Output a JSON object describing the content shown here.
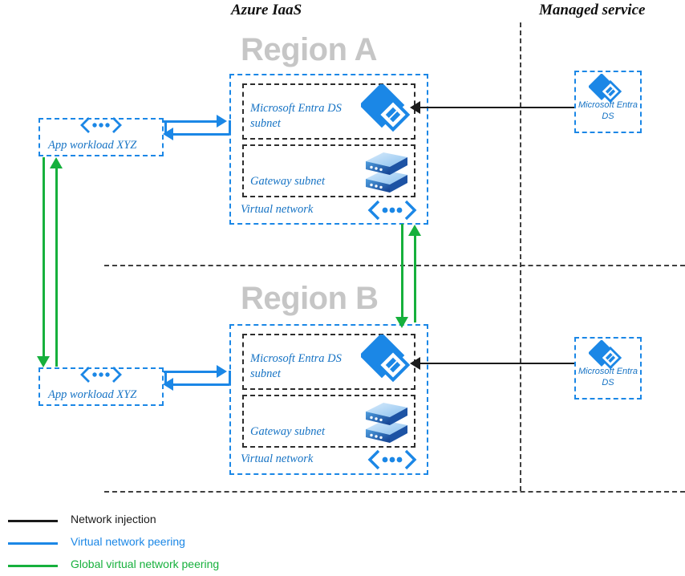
{
  "headers": {
    "azure_iaas": "Azure IaaS",
    "managed_service": "Managed service"
  },
  "regions": [
    {
      "title": "Region A",
      "vnet_label": "Virtual network",
      "vnet_icon": "virtual-network-icon",
      "subnets": [
        {
          "label": "Microsoft Entra DS\nsubnet",
          "icon": "microsoft-entra-ds-icon"
        },
        {
          "label": "Gateway subnet",
          "icon": "gateway-subnet-icon"
        }
      ],
      "workload": {
        "label": "App workload XYZ",
        "icon": "virtual-network-icon"
      },
      "managed": {
        "label": "Microsoft Entra\nDS",
        "icon": "microsoft-entra-ds-icon"
      }
    },
    {
      "title": "Region B",
      "vnet_label": "Virtual network",
      "vnet_icon": "virtual-network-icon",
      "subnets": [
        {
          "label": "Microsoft Entra DS\nsubnet",
          "icon": "microsoft-entra-ds-icon"
        },
        {
          "label": "Gateway subnet",
          "icon": "gateway-subnet-icon"
        }
      ],
      "workload": {
        "label": "App workload XYZ",
        "icon": "virtual-network-icon"
      },
      "managed": {
        "label": "Microsoft Entra\nDS",
        "icon": "microsoft-entra-ds-icon"
      }
    }
  ],
  "legend": {
    "items": [
      {
        "label": "Network injection",
        "color": "#1a1a1a"
      },
      {
        "label": "Virtual network peering",
        "color": "#1b87e6"
      },
      {
        "label": "Global virtual network peering",
        "color": "#16b03c"
      }
    ]
  },
  "colors": {
    "azure_blue": "#1b87e6",
    "label_blue": "#1673c4",
    "green": "#16b03c",
    "black": "#1a1a1a",
    "watermark_gray": "#c6c6c6",
    "divider_gray": "#3f3f3f"
  }
}
